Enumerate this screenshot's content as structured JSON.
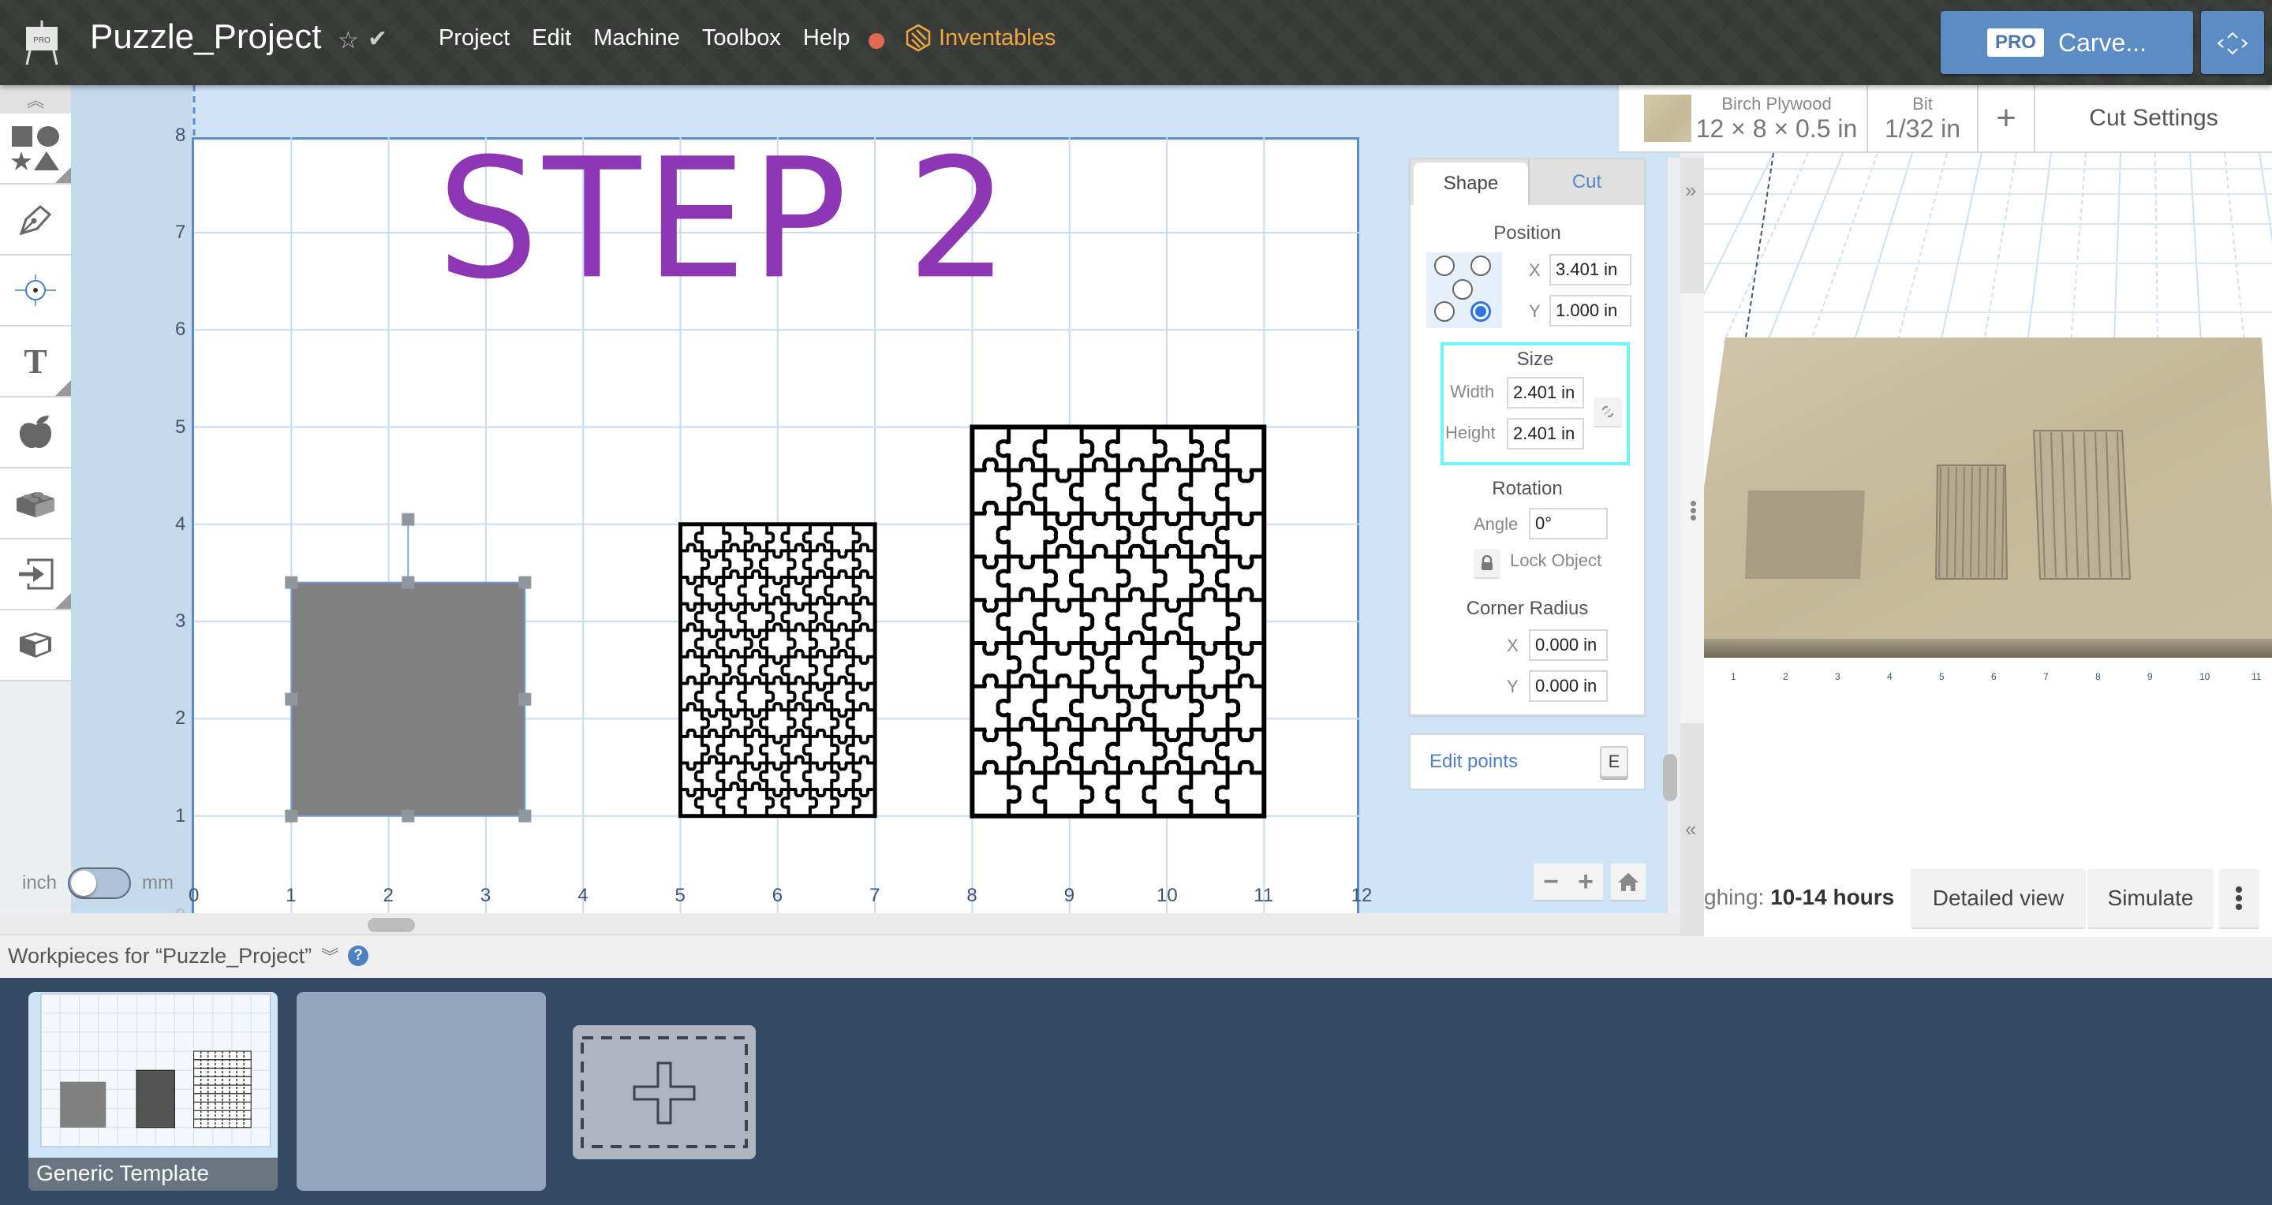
{
  "header": {
    "logo_badge": "PRO",
    "project_title": "Puzzle_Project",
    "menu": [
      "Project",
      "Edit",
      "Machine",
      "Toolbox",
      "Help"
    ],
    "notification_color": "#e06a4d",
    "brand_link": "Inventables",
    "brand_color": "#f0a73d",
    "carve_badge": "PRO",
    "carve_label": "Carve...",
    "accent_color": "#5b8dc4"
  },
  "toolbar": {
    "items": [
      "shapes",
      "pen",
      "point",
      "text",
      "icon-library",
      "apps",
      "import",
      "3d-model"
    ]
  },
  "canvas": {
    "x_ticks": [
      "0",
      "1",
      "2",
      "3",
      "4",
      "5",
      "6",
      "7",
      "8",
      "9",
      "10",
      "11",
      "12"
    ],
    "y_ticks": [
      "1",
      "2",
      "3",
      "4",
      "5",
      "6",
      "7",
      "8"
    ],
    "stray_tick": "0",
    "text_object": "STEP  2",
    "text_color": "#8d37b5",
    "units_left": "inch",
    "units_right": "mm",
    "units_value": "inch",
    "selected_rect": {
      "x_in": 1.0,
      "y_in": 1.0,
      "width_in": 2.401,
      "height_in": 2.401,
      "fill": "#808080"
    },
    "puzzle_small": {
      "x_in": 5.0,
      "y_in": 1.0,
      "width_in": 2.0,
      "height_in": 3.0,
      "cols": 9,
      "rows": 11
    },
    "puzzle_large": {
      "x_in": 8.0,
      "y_in": 1.0,
      "width_in": 3.0,
      "height_in": 4.0,
      "cols": 8,
      "rows": 9
    },
    "zoom_out": "−",
    "zoom_in": "+"
  },
  "inspector": {
    "tabs": [
      "Shape",
      "Cut"
    ],
    "active_tab": "Shape",
    "position_title": "Position",
    "x_label": "X",
    "x_value": "3.401 in",
    "y_label": "Y",
    "y_value": "1.000 in",
    "anchor_selected": "bottom-right",
    "size_title": "Size",
    "width_label": "Width",
    "width_value": "2.401 in",
    "height_label": "Height",
    "height_value": "2.401 in",
    "rotation_title": "Rotation",
    "angle_label": "Angle",
    "angle_value": "0°",
    "lock_label": "Lock Object",
    "corner_title": "Corner Radius",
    "cx_label": "X",
    "cx_value": "0.000 in",
    "cy_label": "Y",
    "cy_value": "0.000 in",
    "edit_points": "Edit points",
    "edit_points_key": "E"
  },
  "material": {
    "name": "Birch Plywood",
    "dims": "12 × 8 × 0.5 in",
    "bit_label": "Bit",
    "bit_value": "1/32 in",
    "add": "+",
    "cut_settings": "Cut Settings"
  },
  "preview": {
    "estimate_prefix": "ghing:",
    "estimate_value": "10-14 hours",
    "detailed_view": "Detailed view",
    "simulate": "Simulate",
    "x_ticks": [
      "1",
      "2",
      "3",
      "4",
      "5",
      "6",
      "7",
      "8",
      "9",
      "10",
      "11"
    ]
  },
  "workpieces": {
    "title": "Workpieces for “Puzzle_Project”",
    "help": "?",
    "cards": [
      {
        "label": "Generic Template",
        "selected": true
      },
      {
        "label": "",
        "selected": false
      }
    ],
    "add_label": "+"
  }
}
